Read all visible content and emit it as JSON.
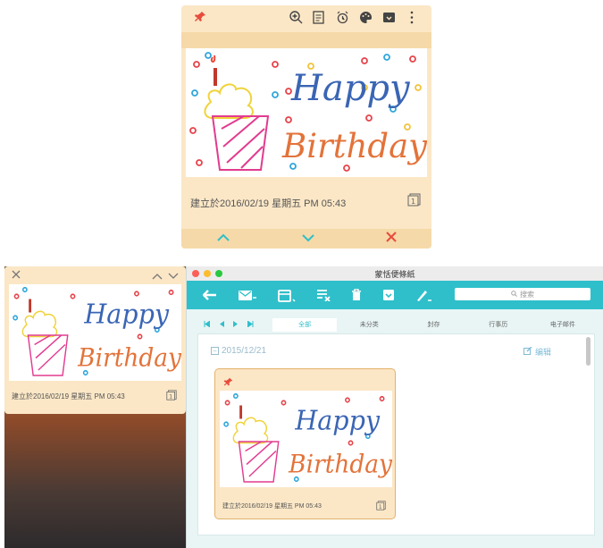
{
  "big_note": {
    "timestamp": "建立於2016/02/19 星期五 PM 05:43",
    "count": "1",
    "pin_icon": "pin-icon",
    "tool_icons": [
      "zoom-in-icon",
      "note-list-icon",
      "alarm-clock-icon",
      "palette-icon",
      "archive-icon",
      "more-vertical-icon"
    ],
    "footer": [
      "^",
      "v",
      "×"
    ]
  },
  "drawing": {
    "happy": "Happy",
    "birthday": "Birthday!"
  },
  "small_note": {
    "close": "×",
    "collapse_up": "^",
    "collapse_down": "v",
    "timestamp": "建立於2016/02/19 星期五 PM 05:43",
    "count": "1"
  },
  "window": {
    "title": "蒙恬便條紙",
    "search_placeholder": "搜索",
    "tabs": [
      "全部",
      "未分类",
      "封存",
      "行事历",
      "电子邮件"
    ],
    "date_group": "2015/12/21",
    "edit_label": "编辑",
    "card_timestamp": "建立於2016/02/19 星期五 PM 05:43",
    "card_count": "1",
    "colors": {
      "toolbar": "#2fbfca",
      "note": "#fbe7c6"
    }
  }
}
